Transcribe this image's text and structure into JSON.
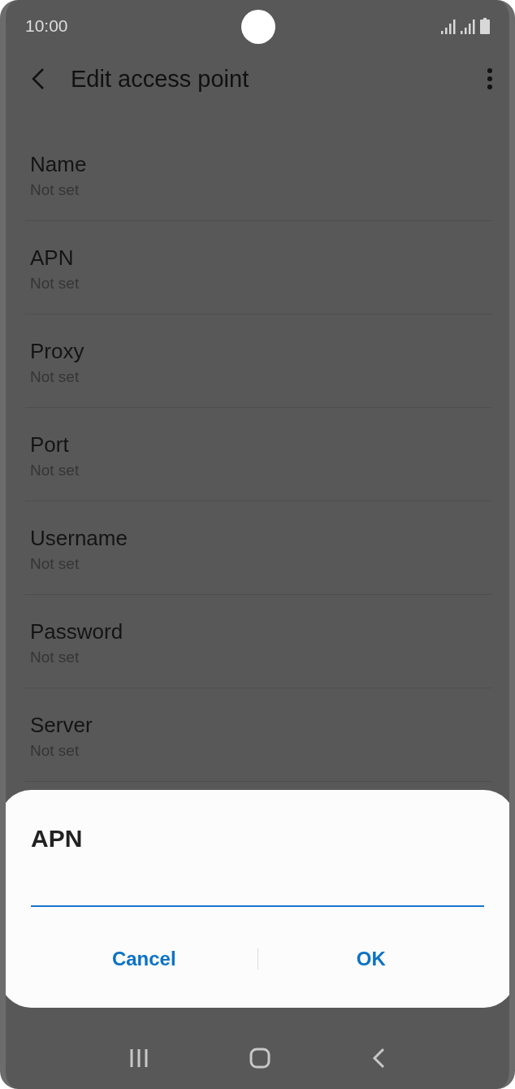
{
  "status_bar": {
    "time": "10:00"
  },
  "toolbar": {
    "title": "Edit access point"
  },
  "settings": [
    {
      "title": "Name",
      "value": "Not set"
    },
    {
      "title": "APN",
      "value": "Not set"
    },
    {
      "title": "Proxy",
      "value": "Not set"
    },
    {
      "title": "Port",
      "value": "Not set"
    },
    {
      "title": "Username",
      "value": "Not set"
    },
    {
      "title": "Password",
      "value": "Not set"
    },
    {
      "title": "Server",
      "value": "Not set"
    }
  ],
  "dialog": {
    "title": "APN",
    "buttons": [
      "Cancel",
      "OK"
    ]
  }
}
